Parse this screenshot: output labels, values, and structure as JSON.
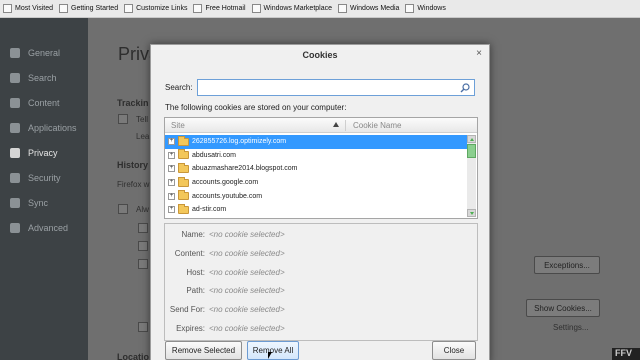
{
  "bookmarks_bar": {
    "items": [
      {
        "label": "Most Visited",
        "icon": "bookmark-icon"
      },
      {
        "label": "Getting Started",
        "icon": "bookmark-icon"
      },
      {
        "label": "Customize Links",
        "icon": "bookmark-icon"
      },
      {
        "label": "Free Hotmail",
        "icon": "bookmark-icon"
      },
      {
        "label": "Windows Marketplace",
        "icon": "bookmark-icon"
      },
      {
        "label": "Windows Media",
        "icon": "bookmark-icon"
      },
      {
        "label": "Windows",
        "icon": "bookmark-icon"
      }
    ]
  },
  "sidebar": {
    "items": [
      {
        "label": "General",
        "icon": "general-icon"
      },
      {
        "label": "Search",
        "icon": "search-icon"
      },
      {
        "label": "Content",
        "icon": "content-icon"
      },
      {
        "label": "Applications",
        "icon": "applications-icon"
      },
      {
        "label": "Privacy",
        "icon": "privacy-mask-icon",
        "active": true
      },
      {
        "label": "Security",
        "icon": "security-icon"
      },
      {
        "label": "Sync",
        "icon": "sync-icon"
      },
      {
        "label": "Advanced",
        "icon": "advanced-icon"
      }
    ]
  },
  "background_page": {
    "title": "Priva",
    "tracking_heading": "Trackin",
    "tracking_text": "Tell",
    "learn_link": "Lea",
    "history_heading": "History",
    "firefox_text": "Firefox w",
    "always_text": "Alw",
    "exceptions_button": "Exceptions...",
    "show_cookies_button": "Show Cookies...",
    "settings_button": "Settings...",
    "location_heading": "Locatio"
  },
  "dialog": {
    "title": "Cookies",
    "close_glyph": "×",
    "search_label": "Search:",
    "search_value": "",
    "following_text": "The following cookies are stored on your computer:",
    "columns": {
      "site": "Site",
      "cookie_name": "Cookie Name"
    },
    "sort_direction": "ascending",
    "sites": [
      {
        "name": "262855726.log.optimizely.com",
        "selected": true
      },
      {
        "name": "abdusatri.com",
        "selected": false
      },
      {
        "name": "abuazmashare2014.blogspot.com",
        "selected": false
      },
      {
        "name": "accounts.google.com",
        "selected": false
      },
      {
        "name": "accounts.youtube.com",
        "selected": false
      },
      {
        "name": "ad-stir.com",
        "selected": false
      }
    ],
    "details": [
      {
        "label": "Name:",
        "value": "<no cookie selected>"
      },
      {
        "label": "Content:",
        "value": "<no cookie selected>"
      },
      {
        "label": "Host:",
        "value": "<no cookie selected>"
      },
      {
        "label": "Path:",
        "value": "<no cookie selected>"
      },
      {
        "label": "Send For:",
        "value": "<no cookie selected>"
      },
      {
        "label": "Expires:",
        "value": "<no cookie selected>"
      }
    ],
    "buttons": {
      "remove_selected": "Remove Selected",
      "remove_all": "Remove All",
      "close": "Close"
    }
  },
  "watermark_text": "FFV",
  "colors": {
    "selection": "#3399ff",
    "sidebar_bg": "#3d4245",
    "scroll_accent": "#4caf50"
  }
}
